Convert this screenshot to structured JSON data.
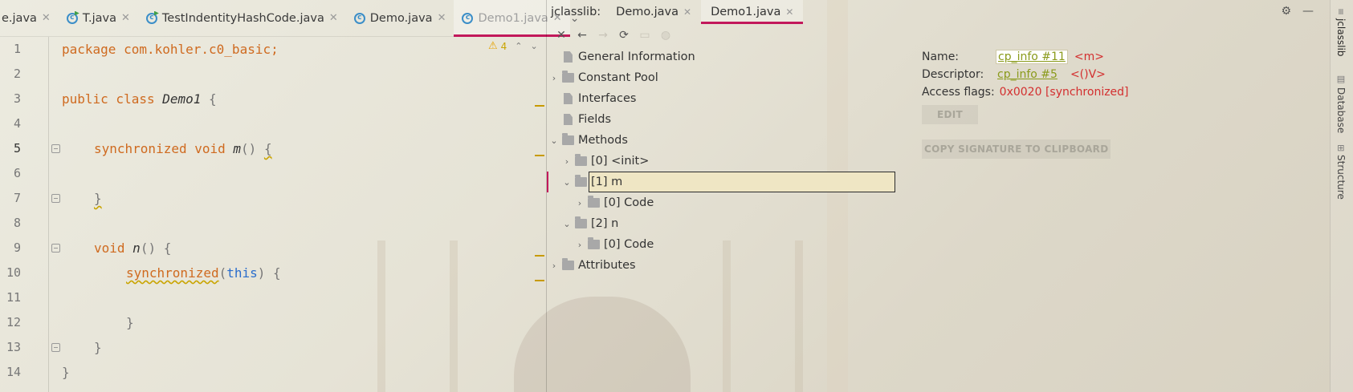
{
  "editor": {
    "tabs": [
      {
        "label": "e.java",
        "icon": "file-icon",
        "active": false
      },
      {
        "label": "T.java",
        "icon": "class-icon",
        "active": false
      },
      {
        "label": "TestIndentityHashCode.java",
        "icon": "class-icon",
        "active": false
      },
      {
        "label": "Demo.java",
        "icon": "class-icon",
        "active": false
      },
      {
        "label": "Demo1.java",
        "icon": "class-icon",
        "active": true
      }
    ],
    "warnings_count": "4",
    "lines": [
      "1",
      "2",
      "3",
      "4",
      "5",
      "6",
      "7",
      "8",
      "9",
      "10",
      "11",
      "12",
      "13",
      "14"
    ],
    "code": {
      "l1_kw": "package",
      "l1_pkg": " com.kohler.c0_basic;",
      "l3_kw1": "public",
      "l3_kw2": " class ",
      "l3_name": "Demo1",
      "l3_rest": " {",
      "l5_kw1": "synchronized",
      "l5_kw2": " void ",
      "l5_name": "m",
      "l5_rest": "() ",
      "l5_brace": "{",
      "l7_brace": "}",
      "l9_kw": "void",
      "l9_space": " ",
      "l9_name": "n",
      "l9_rest": "() {",
      "l10_ann": "synchronized",
      "l10_p1": "(",
      "l10_this": "this",
      "l10_p2": ") {",
      "l12": "}",
      "l13": "}",
      "l14": "}"
    }
  },
  "jclasslib": {
    "label": "jclasslib:",
    "tabs": [
      {
        "label": "Demo.java",
        "active": false
      },
      {
        "label": "Demo1.java",
        "active": true
      }
    ],
    "tree": {
      "general": "General Information",
      "constant_pool": "Constant Pool",
      "interfaces": "Interfaces",
      "fields": "Fields",
      "methods": "Methods",
      "m0": "[0] <init>",
      "m1": "[1] m",
      "m1_code": "[0] Code",
      "m2": "[2] n",
      "m2_code": "[0] Code",
      "attributes": "Attributes"
    },
    "details": {
      "name_label": "Name:",
      "name_link": "cp_info #11",
      "name_value": "<m>",
      "desc_label": "Descriptor:",
      "desc_link": "cp_info #5",
      "desc_value": "<()V>",
      "access_label": "Access flags:",
      "access_value": "0x0020 [synchronized]",
      "edit_btn": "EDIT",
      "copy_btn": "COPY SIGNATURE TO CLIPBOARD"
    }
  },
  "right_strip": {
    "items": [
      "jclasslib",
      "Database",
      "Structure"
    ]
  },
  "colors": {
    "accent": "#c2185b",
    "keyword": "#cf6a1f",
    "link": "#8a9a1a",
    "flags": "#d32f2f"
  }
}
